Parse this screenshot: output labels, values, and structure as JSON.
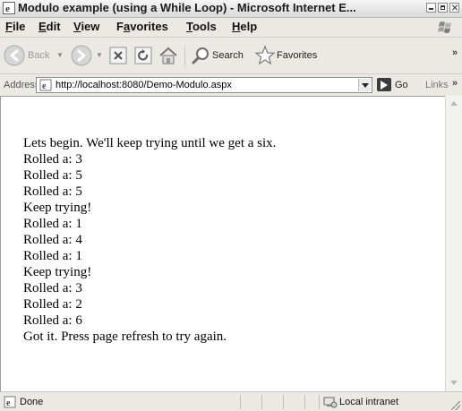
{
  "window": {
    "title": "Modulo example (using a While Loop) - Microsoft Internet E..."
  },
  "menu": [
    {
      "label": "File",
      "accel": "F",
      "rest": "ile"
    },
    {
      "label": "Edit",
      "accel": "E",
      "rest": "dit"
    },
    {
      "label": "View",
      "accel": "V",
      "rest": "iew"
    },
    {
      "label": "Favorites",
      "pre": "F",
      "accel": "a",
      "rest": "vorites"
    },
    {
      "label": "Tools",
      "accel": "T",
      "rest": "ools"
    },
    {
      "label": "Help",
      "accel": "H",
      "rest": "elp"
    }
  ],
  "toolbar": {
    "back": "Back",
    "search": "Search",
    "favorites": "Favorites",
    "overflow": "»"
  },
  "address": {
    "label": "Address",
    "url": "http://localhost:8080/Demo-Modulo.aspx",
    "go": "Go",
    "links": "Links",
    "overflow": "»"
  },
  "content": {
    "lines": [
      "Lets begin. We'll keep trying until we get a six.",
      "Rolled a: 3",
      "Rolled a: 5",
      "Rolled a: 5",
      "Keep trying!",
      "Rolled a: 1",
      "Rolled a: 4",
      "Rolled a: 1",
      "Keep trying!",
      "Rolled a: 3",
      "Rolled a: 2",
      "Rolled a: 6",
      "Got it. Press page refresh to try again."
    ]
  },
  "status": {
    "text": "Done",
    "zone": "Local intranet"
  },
  "icons": {
    "ie": "internet-explorer-icon",
    "windows_flag": "windows-flag-icon",
    "back": "back-arrow-icon",
    "forward": "forward-arrow-icon",
    "stop": "stop-icon",
    "refresh": "refresh-icon",
    "home": "home-icon",
    "search": "search-magnifier-icon",
    "favorites": "favorites-star-icon",
    "page": "page-icon",
    "go": "go-arrow-icon",
    "zone": "local-intranet-icon"
  }
}
